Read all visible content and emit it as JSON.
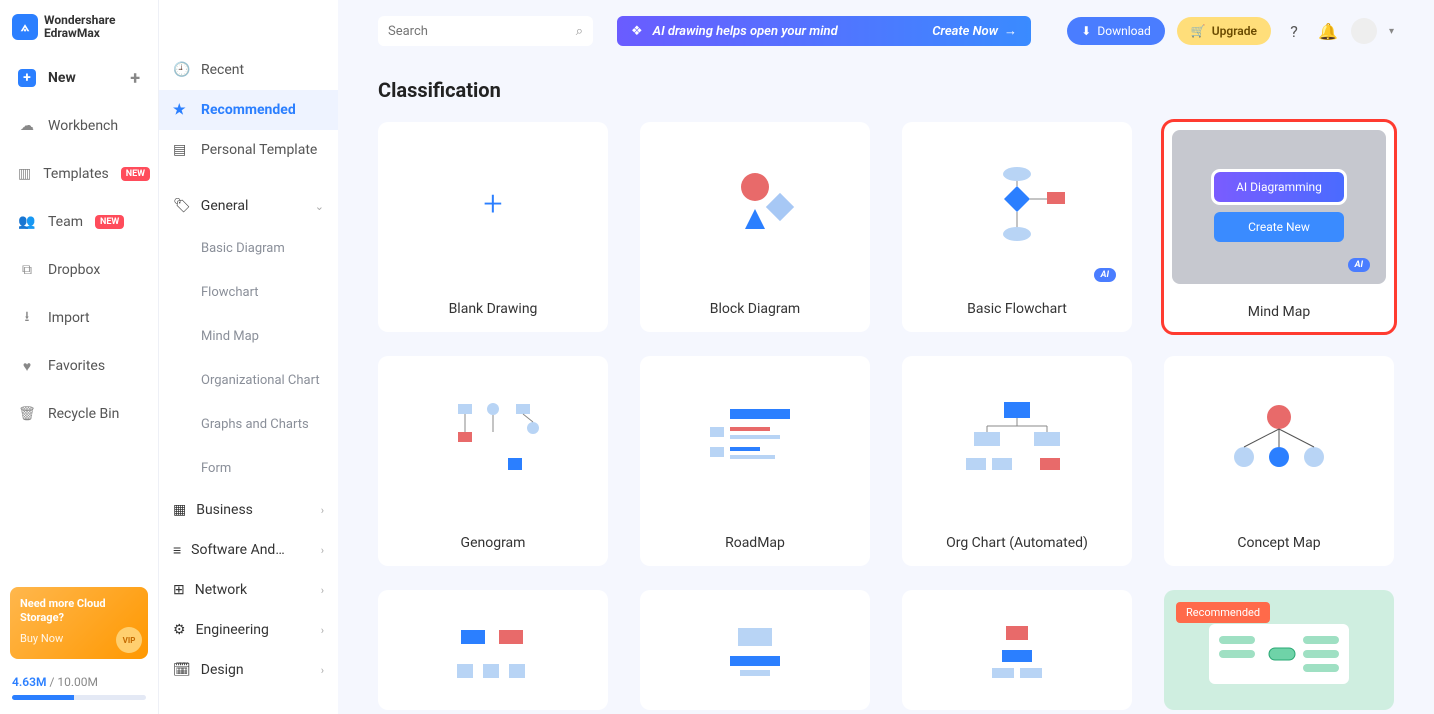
{
  "app": {
    "name_line1": "Wondershare",
    "name_line2": "EdrawMax"
  },
  "nav": {
    "new": "New",
    "workbench": "Workbench",
    "templates": "Templates",
    "templates_badge": "NEW",
    "team": "Team",
    "team_badge": "NEW",
    "dropbox": "Dropbox",
    "import": "Import",
    "favorites": "Favorites",
    "recycle": "Recycle Bin"
  },
  "cloud_promo": {
    "title": "Need more Cloud Storage?",
    "action": "Buy Now",
    "vip": "VIP"
  },
  "storage": {
    "used": "4.63M",
    "total": "10.00M"
  },
  "mid": {
    "recent": "Recent",
    "recommended": "Recommended",
    "personal": "Personal Template",
    "general": "General",
    "general_subs": [
      "Basic Diagram",
      "Flowchart",
      "Mind Map",
      "Organizational Chart",
      "Graphs and Charts",
      "Form"
    ],
    "groups": [
      "Business",
      "Software And…",
      "Network",
      "Engineering",
      "Design"
    ]
  },
  "search": {
    "placeholder": "Search"
  },
  "banner": {
    "text": "AI drawing helps open your mind",
    "cta": "Create Now"
  },
  "top": {
    "download": "Download",
    "upgrade": "Upgrade"
  },
  "section_title": "Classification",
  "cards": {
    "blank": "Blank Drawing",
    "block": "Block Diagram",
    "flow": "Basic Flowchart",
    "mind": "Mind Map",
    "genogram": "Genogram",
    "roadmap": "RoadMap",
    "org": "Org Chart (Automated)",
    "concept": "Concept Map",
    "ai_tag": "AI",
    "ai_btn": "AI Diagramming",
    "create_btn": "Create New",
    "recommended_tag": "Recommended"
  }
}
